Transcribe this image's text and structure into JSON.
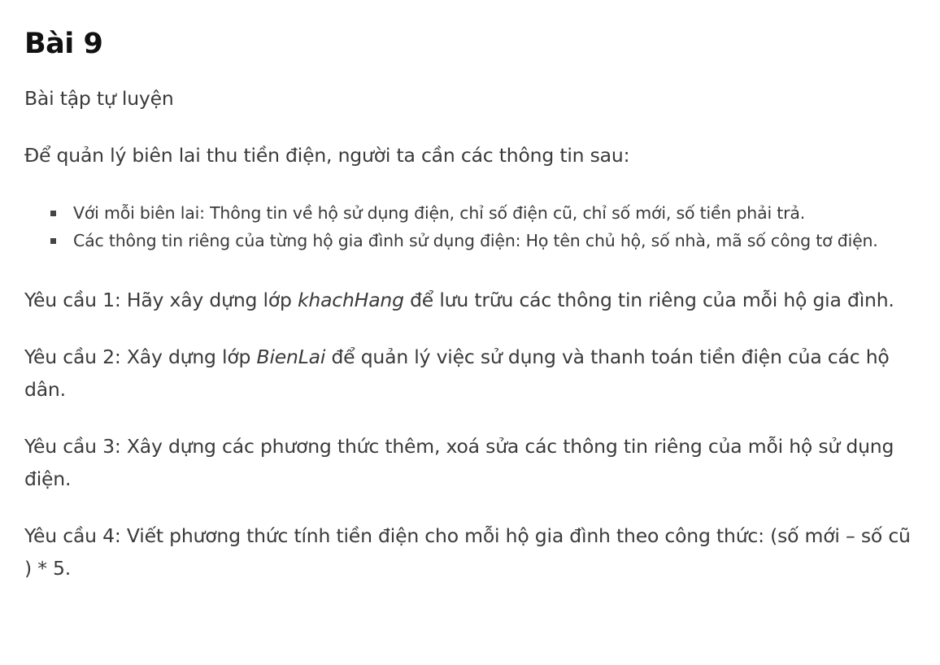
{
  "heading": "Bài 9",
  "subtitle": "Bài tập tự luyện",
  "intro": "Để quản lý biên lai thu tiền điện, người ta cần các thông tin sau:",
  "bullets": [
    "Với mỗi biên lai: Thông tin về hộ sử dụng điện, chỉ số điện cũ, chỉ số mới, số tiền phải trả.",
    "Các thông tin riêng của từng hộ gia đình sử dụng điện: Họ tên chủ hộ, số nhà, mã số công tơ điện."
  ],
  "requirements": [
    {
      "prefix": "Yêu cầu 1: Hãy xây dựng lớp ",
      "class_name": "khachHang",
      "suffix": " để lưu trữu các thông tin riêng của mỗi hộ gia đình."
    },
    {
      "prefix": "Yêu cầu 2: Xây dựng lớp ",
      "class_name": "BienLai",
      "suffix": " để quản lý việc sử dụng và thanh toán tiền điện của các hộ dân."
    },
    {
      "text": "Yêu cầu 3: Xây dựng các phương thức thêm, xoá sửa các thông tin riêng của mỗi hộ sử dụng điện."
    },
    {
      "text": "Yêu cầu 4: Viết phương thức tính tiền điện cho mỗi hộ gia đình theo công thức: (số mới – số cũ ) * 5."
    }
  ]
}
